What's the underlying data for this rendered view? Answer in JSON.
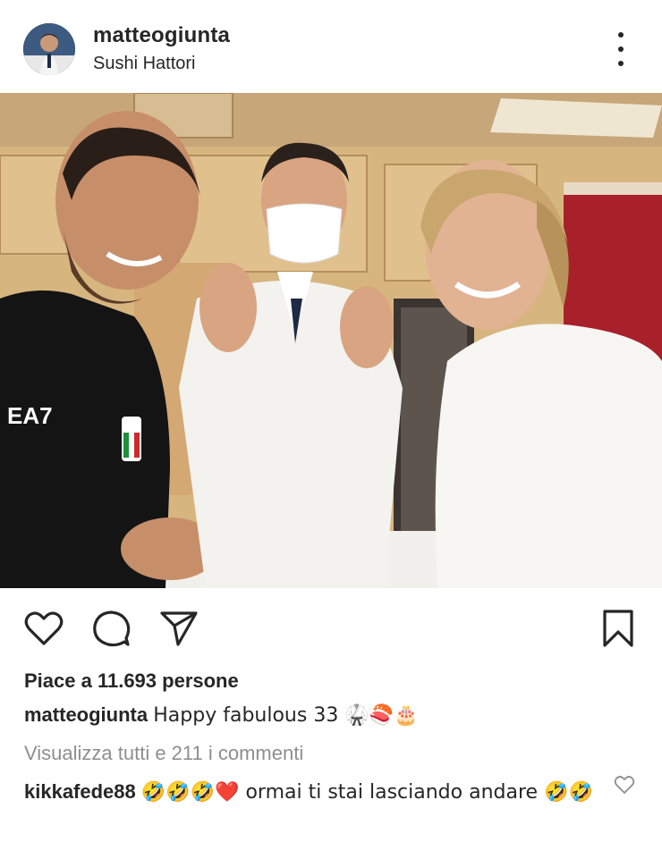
{
  "post": {
    "username": "matteogiunta",
    "location": "Sushi Hattori",
    "likes_text": "Piace a 11.693 persone",
    "caption_user": "matteogiunta",
    "caption_text": "Happy fabulous 33 🥋🍣🎂",
    "view_comments": "Visualizza tutti e 211 i commenti",
    "comment": {
      "user": "kikkafede88",
      "text": "🤣🤣🤣❤️ ormai ti stai lasciando andare 🤣🤣"
    }
  },
  "icons": {
    "more": "more-vertical-icon",
    "like": "heart-icon",
    "comment": "comment-bubble-icon",
    "share": "paper-plane-icon",
    "save": "bookmark-icon",
    "comment_like": "heart-outline-small-icon"
  },
  "colors": {
    "text": "#262626",
    "secondary": "#8e8e8e",
    "background": "#ffffff"
  }
}
